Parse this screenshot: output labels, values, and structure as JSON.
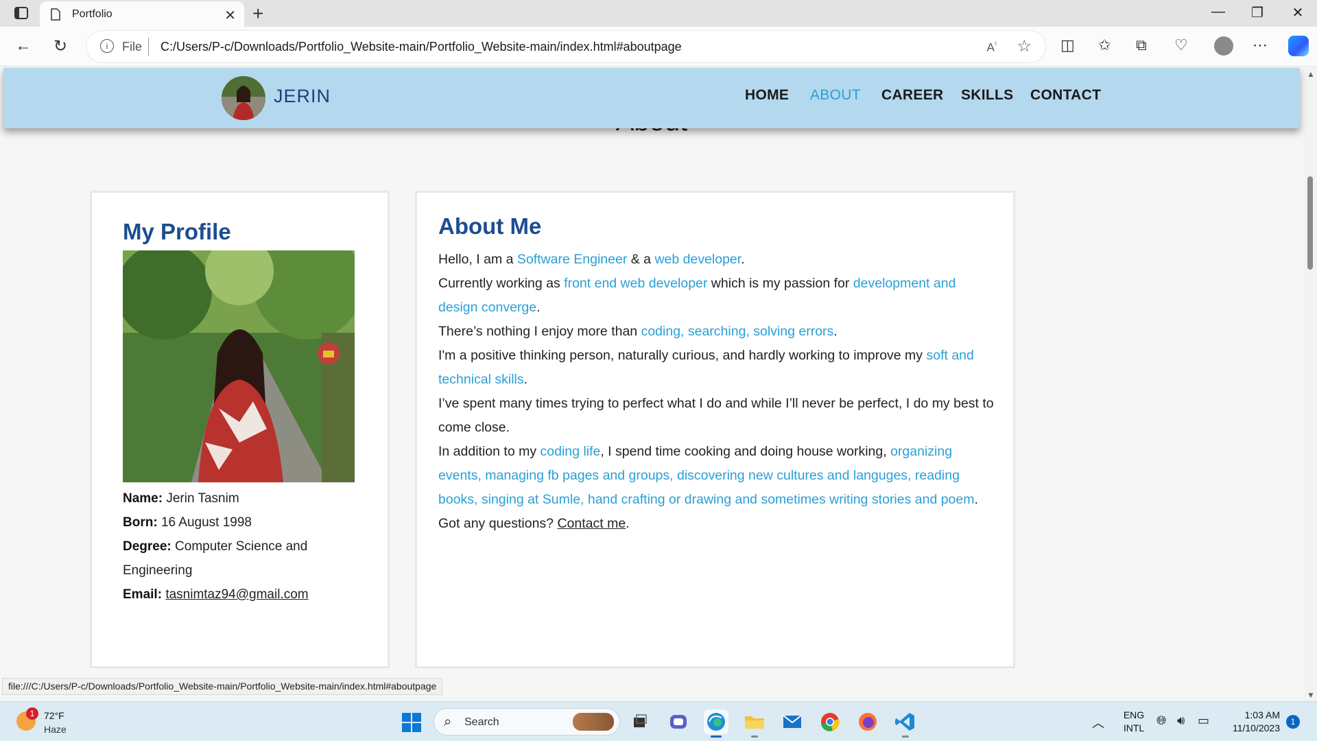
{
  "browser": {
    "tab_title": "Portfolio",
    "address_prefix": "File",
    "url": "C:/Users/P-c/Downloads/Portfolio_Website-main/Portfolio_Website-main/index.html#aboutpage",
    "status_url": "file:///C:/Users/P-c/Downloads/Portfolio_Website-main/Portfolio_Website-main/index.html#aboutpage"
  },
  "site": {
    "brand": "JERIN",
    "nav": [
      {
        "label": "HOME",
        "active": false
      },
      {
        "label": "ABOUT",
        "active": true
      },
      {
        "label": "CAREER",
        "active": false
      },
      {
        "label": "SKILLS",
        "active": false
      },
      {
        "label": "CONTACT",
        "active": false
      }
    ],
    "heading": "About"
  },
  "profile": {
    "title": "My Profile",
    "name_label": "Name:",
    "name": "Jerin Tasnim",
    "born_label": "Born:",
    "born": "16 August 1998",
    "degree_label": "Degree:",
    "degree": "Computer Science and Engineering",
    "email_label": "Email:",
    "email": "tasnimtaz94@gmail.com"
  },
  "about": {
    "title": "About Me",
    "p1a": "Hello, I am a ",
    "p1b": "Software Engineer",
    "p1c": " & a ",
    "p1d": "web developer",
    "p1e": ".",
    "p2a": "Currently working as ",
    "p2b": "front end web developer",
    "p2c": " which is my passion for ",
    "p2d": "development and design converge",
    "p2e": ".",
    "p3a": "There’s nothing I enjoy more than ",
    "p3b": "coding, searching, solving errors",
    "p3c": ".",
    "p4a": "I'm a positive thinking person, naturally curious, and hardly working to improve my ",
    "p4b": "soft and technical skills",
    "p4c": ".",
    "p5": "I’ve spent many times trying to perfect what I do and while I’ll never be perfect, I do my best to come close.",
    "p6a": "In addition to my ",
    "p6b": "coding life",
    "p6c": ", I spend time cooking and doing house working, ",
    "p6d": "organizing events, managing fb pages and groups, discovering new cultures and languges, reading books, singing at Sumle, hand crafting or drawing and sometimes writing stories and poem",
    "p6e": ".",
    "p7a": "Got any questions? ",
    "p7b": "Contact me",
    "p7c": "."
  },
  "taskbar": {
    "weather_badge": "1",
    "temperature": "72°F",
    "condition": "Haze",
    "search_label": "Search",
    "lang1": "ENG",
    "lang2": "INTL",
    "time": "1:03 AM",
    "date": "11/10/2023",
    "notifications": "1"
  },
  "colors": {
    "header_bg": "#b4d8ee",
    "accent": "#2a9fd6",
    "title_blue": "#1d4d8f"
  }
}
